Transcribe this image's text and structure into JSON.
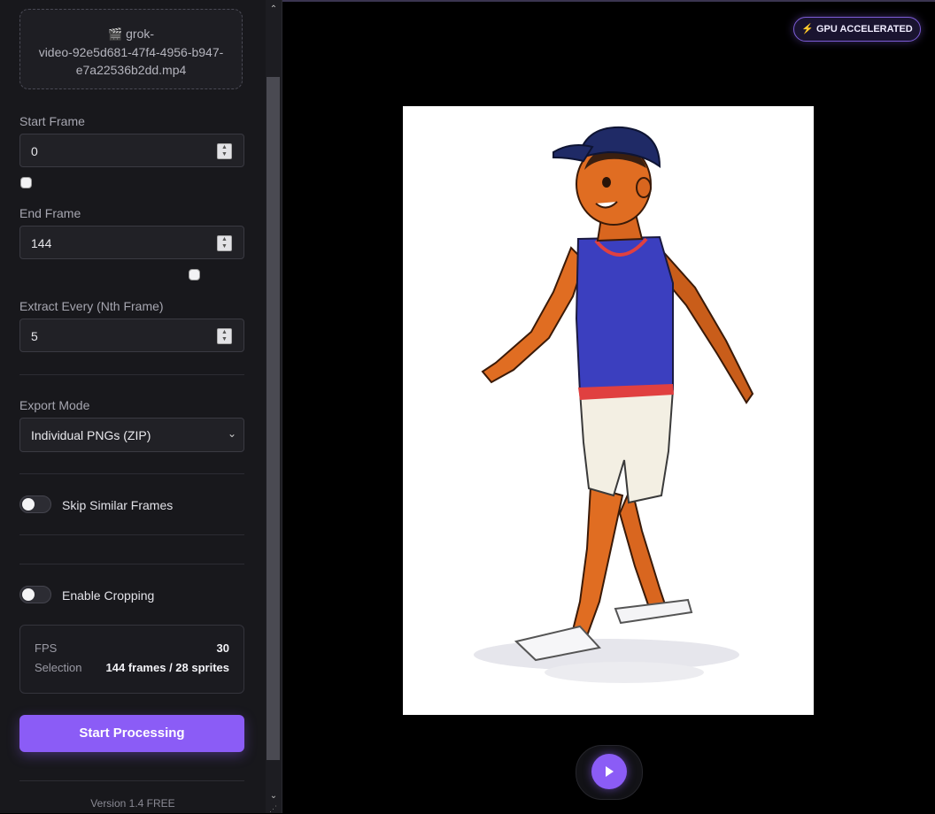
{
  "file": {
    "icon": "clapperboard-icon",
    "name_line1": "grok-",
    "name_line2": "video-92e5d681-47f4-4956-b947-",
    "name_line3": "e7a22536b2dd.mp4"
  },
  "start_frame": {
    "label": "Start Frame",
    "value": "0"
  },
  "end_frame": {
    "label": "End Frame",
    "value": "144"
  },
  "extract_every": {
    "label": "Extract Every (Nth Frame)",
    "value": "5"
  },
  "export_mode": {
    "label": "Export Mode",
    "selected": "Individual PNGs (ZIP)"
  },
  "skip_similar": {
    "label": "Skip Similar Frames",
    "enabled": false
  },
  "cropping": {
    "label": "Enable Cropping",
    "enabled": false
  },
  "stats": {
    "fps_label": "FPS",
    "fps_value": "30",
    "selection_label": "Selection",
    "selection_value": "144 frames / 28 sprites"
  },
  "start_button": "Start Processing",
  "version": "Version 1.4 FREE",
  "gpu_badge": {
    "icon": "lightning-icon",
    "label": "GPU ACCELERATED"
  },
  "preview": {
    "subject": "cartoon boy walking"
  },
  "colors": {
    "accent": "#8b5cf6",
    "sidebar": "#18181c",
    "background": "#000000"
  }
}
